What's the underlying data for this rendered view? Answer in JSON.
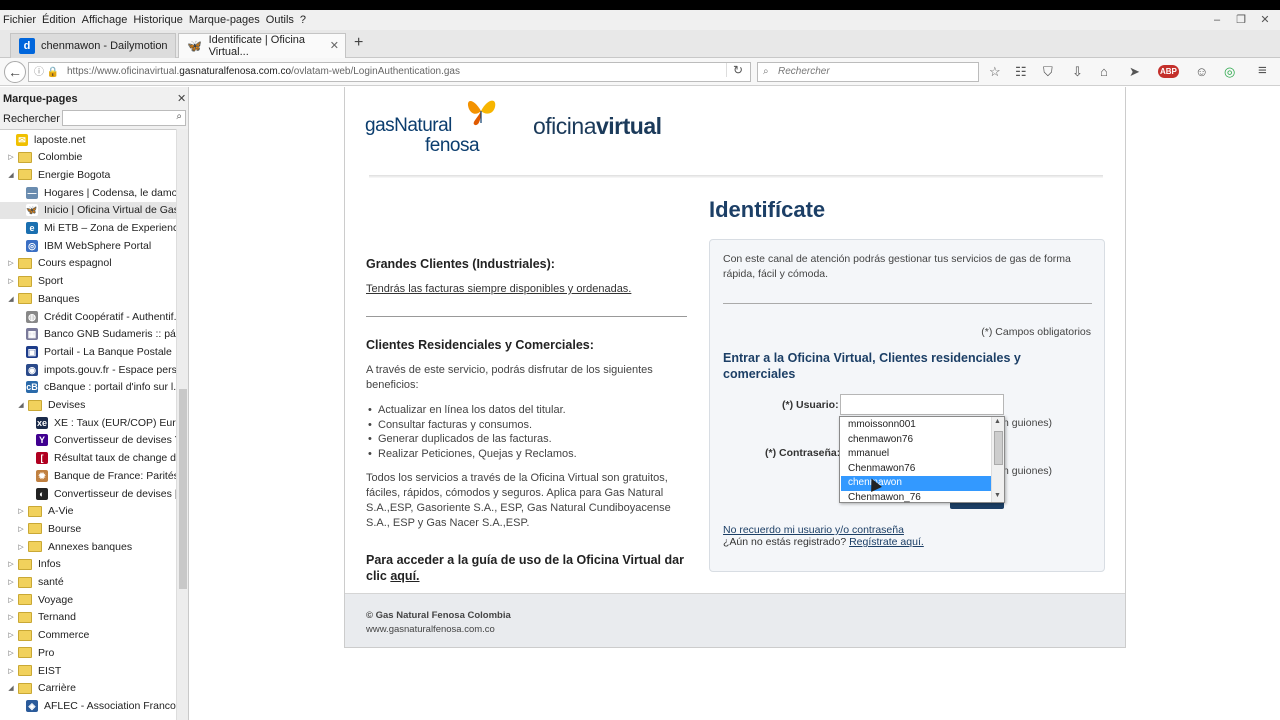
{
  "menu": [
    "Fichier",
    "Édition",
    "Affichage",
    "Historique",
    "Marque-pages",
    "Outils",
    "?"
  ],
  "window_controls": [
    "–",
    "❐",
    "✕"
  ],
  "tabs": [
    {
      "label": "chenmawon - Dailymotion",
      "icon": "d"
    },
    {
      "label": "Identificate | Oficina Virtual...",
      "icon": "🦋"
    }
  ],
  "tab_close": "✕",
  "new_tab": "+",
  "nav": {
    "back": "←",
    "url_prefix": "https://www.oficinavirtual.",
    "url_domain": "gasnaturalfenosa.com.co",
    "url_suffix": "/ovlatam-web/LoginAuthentication.gas",
    "url_icons": "ⓘ 🔒",
    "reload": "↻",
    "search_placeholder": "Rechercher",
    "search_icon": "⌕"
  },
  "toolbar_icons": [
    "☆",
    "☷",
    "⛉",
    "⇩",
    "⌂",
    "➤",
    "ABP",
    "☺",
    "◎",
    "≡"
  ],
  "sidebar": {
    "title": "Marque-pages",
    "close": "✕",
    "search_label": "Rechercher :",
    "search_icon": "⌕",
    "items": [
      {
        "label": "laposte.net",
        "type": "bm",
        "depth": 1,
        "icon": "✉",
        "color": "#f0c000"
      },
      {
        "label": "Colombie",
        "type": "folder",
        "depth": 0,
        "twisty": "▷"
      },
      {
        "label": "Energie Bogota",
        "type": "folder",
        "depth": 0,
        "twisty": "◢"
      },
      {
        "label": "Hogares | Codensa, le damo...",
        "type": "bm",
        "depth": 2,
        "icon": "—",
        "color": "#6a8caf"
      },
      {
        "label": "Inicio | Oficina Virtual de Gas...",
        "type": "bm",
        "depth": 2,
        "icon": "🦋",
        "color": "#ffffff",
        "selected": true
      },
      {
        "label": "Mi ETB – Zona de Experienci...",
        "type": "bm",
        "depth": 2,
        "icon": "e",
        "color": "#1a6fb0"
      },
      {
        "label": "IBM WebSphere Portal",
        "type": "bm",
        "depth": 2,
        "icon": "◎",
        "color": "#3a6fc4"
      },
      {
        "label": "Cours espagnol",
        "type": "folder",
        "depth": 0,
        "twisty": "▷"
      },
      {
        "label": "Sport",
        "type": "folder",
        "depth": 0,
        "twisty": "▷"
      },
      {
        "label": "Banques",
        "type": "folder",
        "depth": 0,
        "twisty": "◢"
      },
      {
        "label": "Crédit Coopératif - Authentif...",
        "type": "bm",
        "depth": 2,
        "icon": "◍",
        "color": "#888888"
      },
      {
        "label": "Banco GNB Sudameris :: pág...",
        "type": "bm",
        "depth": 2,
        "icon": "▦",
        "color": "#7a7a9a"
      },
      {
        "label": "Portail - La Banque Postale",
        "type": "bm",
        "depth": 2,
        "icon": "▣",
        "color": "#1d3c8a"
      },
      {
        "label": "impots.gouv.fr - Espace pers...",
        "type": "bm",
        "depth": 2,
        "icon": "◉",
        "color": "#2a4a8a"
      },
      {
        "label": "cBanque : portail d'info sur l...",
        "type": "bm",
        "depth": 2,
        "icon": "cB",
        "color": "#2a6aaa"
      },
      {
        "label": "Devises",
        "type": "folder",
        "depth": 1,
        "twisty": "◢"
      },
      {
        "label": "XE : Taux (EUR/COP) Euro ...",
        "type": "bm",
        "depth": 3,
        "icon": "xe",
        "color": "#1a2a4a"
      },
      {
        "label": "Convertisseur de devises Y...",
        "type": "bm",
        "depth": 3,
        "icon": "Y",
        "color": "#400090"
      },
      {
        "label": "Résultat taux de change d...",
        "type": "bm",
        "depth": 3,
        "icon": "[",
        "color": "#b00020"
      },
      {
        "label": "Banque de France: Parités ...",
        "type": "bm",
        "depth": 3,
        "icon": "✹",
        "color": "#c08040"
      },
      {
        "label": "Convertisseur de devises | ...",
        "type": "bm",
        "depth": 3,
        "icon": "◐",
        "color": "#222222"
      },
      {
        "label": "A-Vie",
        "type": "folder",
        "depth": 1,
        "twisty": "▷"
      },
      {
        "label": "Bourse",
        "type": "folder",
        "depth": 1,
        "twisty": "▷"
      },
      {
        "label": "Annexes banques",
        "type": "folder",
        "depth": 1,
        "twisty": "▷"
      },
      {
        "label": "Infos",
        "type": "folder",
        "depth": 0,
        "twisty": "▷"
      },
      {
        "label": "santé",
        "type": "folder",
        "depth": 0,
        "twisty": "▷"
      },
      {
        "label": "Voyage",
        "type": "folder",
        "depth": 0,
        "twisty": "▷"
      },
      {
        "label": "Ternand",
        "type": "folder",
        "depth": 0,
        "twisty": "▷"
      },
      {
        "label": "Commerce",
        "type": "folder",
        "depth": 0,
        "twisty": "▷"
      },
      {
        "label": "Pro",
        "type": "folder",
        "depth": 0,
        "twisty": "▷"
      },
      {
        "label": "EIST",
        "type": "folder",
        "depth": 0,
        "twisty": "▷"
      },
      {
        "label": "Carrière",
        "type": "folder",
        "depth": 0,
        "twisty": "◢"
      },
      {
        "label": "AFLEC - Association Franco ...",
        "type": "bm",
        "depth": 2,
        "icon": "◈",
        "color": "#2a5a9a"
      }
    ]
  },
  "page": {
    "logo_gas": "gasNatural",
    "logo_fenosa": "fenosa",
    "oficina_light": "oficina",
    "oficina_bold": "virtual",
    "grandes_title": "Grandes Clientes (Industriales):",
    "grandes_link": "Tendrás las facturas siempre disponibles y ordenadas.",
    "res_title": "Clientes Residenciales y Comerciales:",
    "res_intro": "A través de este servicio, podrás disfrutar de los siguientes beneficios:",
    "benefits": [
      "Actualizar en línea los datos del titular.",
      "Consultar facturas y consumos.",
      "Generar duplicados de las facturas.",
      "Realizar Peticiones, Quejas y Reclamos."
    ],
    "all_services": "Todos los servicios a través de la Oficina Virtual son gratuitos, fáciles, rápidos, cómodos y seguros. Aplica para Gas Natural S.A.,ESP, Gasoriente S.A., ESP, Gas Natural Cundiboyacense S.A., ESP y Gas Nacer S.A.,ESP.",
    "guide_text": "Para acceder a la guía de uso de la Oficina Virtual dar clic",
    "guide_link": "aquí.",
    "identificate": "Identifícate",
    "panel_intro": "Con este canal de atención podrás gestionar tus servicios de gas de forma rápida, fácil y cómoda.",
    "required": "(*) Campos obligatorios",
    "panel_heading": "Entrar a la Oficina Virtual, Clientes residenciales y comerciales",
    "user_label": "(*) Usuario:",
    "pass_label": "(*) Contraseña:",
    "user_hint": "n guiones)",
    "pass_hint": "n guiones)",
    "forgot": "No recuerdo mi usuario y/o contraseña",
    "not_registered": "¿Aún no estás registrado?",
    "register": "Regístrate aquí.",
    "footer_copy": "© Gas Natural Fenosa Colombia",
    "footer_url": "www.gasnaturalfenosa.com.co"
  },
  "autocomplete": {
    "items": [
      "mmoissonn001",
      "chenmawon76",
      "mmanuel",
      "Chenmawon76",
      "chenmawon",
      "Chenmawon_76"
    ],
    "highlighted": 4,
    "arrow_up": "▲",
    "arrow_down": "▼"
  },
  "colors": {
    "brand": "#1c3f66",
    "highlight": "#3399ff"
  }
}
